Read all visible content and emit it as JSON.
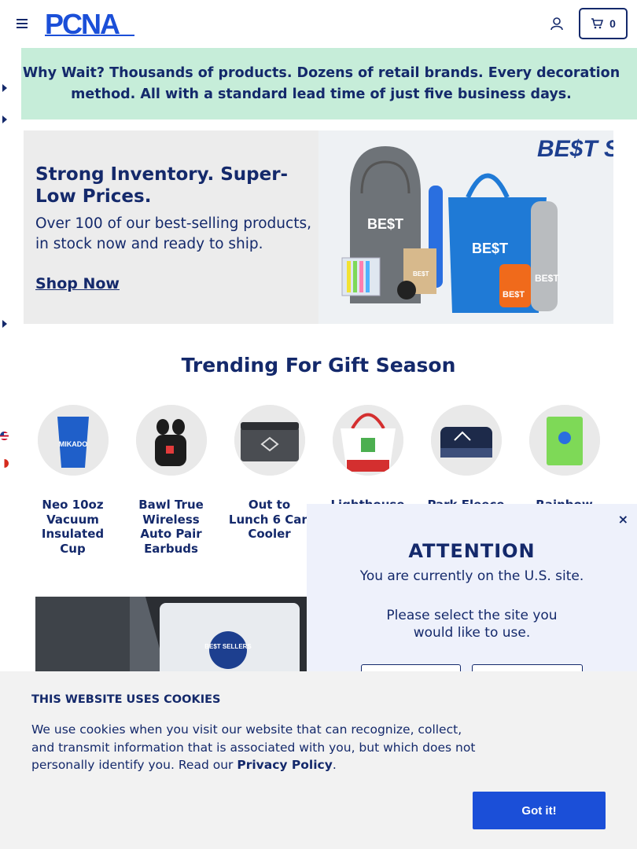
{
  "header": {
    "logo_text": "PCNA",
    "cart_count": "0",
    "icons": [
      "menu-icon",
      "user-icon",
      "cart-icon"
    ]
  },
  "banner": {
    "text": "Why Wait? Thousands of products. Dozens of retail brands. Every decoration method. All with a standard lead time of just five business days."
  },
  "hero": {
    "title": "Strong Inventory. Super-Low Prices.",
    "subtitle": "Over 100 of our best-selling products, in stock now and ready to ship.",
    "link": "Shop Now",
    "image_badge": "BE$T SELLERS",
    "image_item_label": "BE$T"
  },
  "trending": {
    "title": "Trending For Gift Season",
    "products": [
      {
        "name": "Neo 10oz Vacuum Insulated Cup",
        "thumb_label": "MIKADO",
        "color": "#1f5fc9"
      },
      {
        "name": "Bawl True Wireless Auto Pair Earbuds",
        "color": "#1c1c1c"
      },
      {
        "name": "Out to Lunch 6 Can Cooler",
        "color": "#4a4d52"
      },
      {
        "name": "Lighthouse",
        "color": "#d42f2f"
      },
      {
        "name": "Park Fleece",
        "color": "#1d2a4a"
      },
      {
        "name": "Rainbow",
        "color": "#7ed957"
      }
    ]
  },
  "promo2": {
    "badge": "BE$T SELLERS"
  },
  "modal": {
    "close": "×",
    "title": "ATTENTION",
    "text1": "You are currently on the U.S. site.",
    "text2": "Please select the site you would like to use."
  },
  "cookie": {
    "title": "THIS WEBSITE USES COOKIES",
    "text_before": "We use cookies when you visit our website that can recognize, collect, and transmit information that is associated with you, but which does not personally identify you. Read our ",
    "link": "Privacy Policy",
    "text_after": ".",
    "button": "Got it!"
  },
  "colors": {
    "navy": "#14296b",
    "banner_bg": "#c6edd9",
    "cta_blue": "#1b4fd8"
  }
}
